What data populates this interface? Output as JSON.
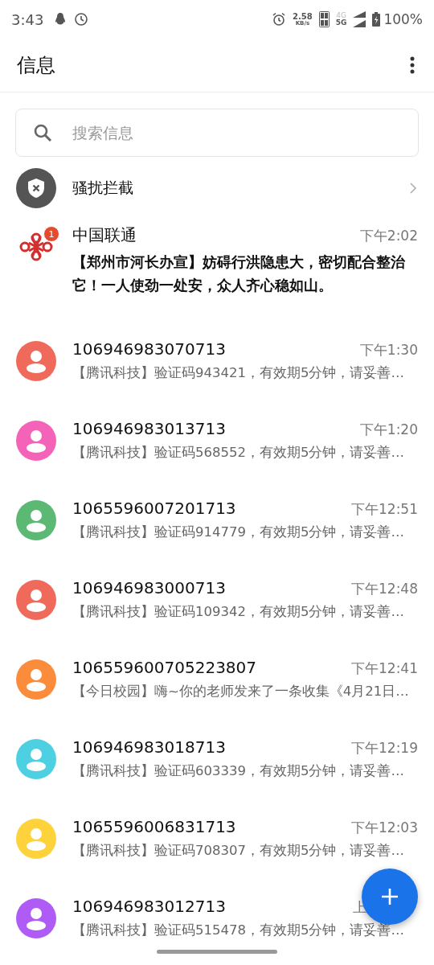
{
  "status_bar": {
    "time": "3:43",
    "net_speed": "2.58",
    "net_unit": "KB/s",
    "sim_top": "4G",
    "sim_bottom": "5G",
    "battery": "100%"
  },
  "header": {
    "title": "信息"
  },
  "search": {
    "placeholder": "搜索信息"
  },
  "spam_filter": {
    "label": "骚扰拦截"
  },
  "conversations": [
    {
      "kind": "logo",
      "name": "中国联通",
      "time": "下午2:02",
      "preview": "【郑州市河长办宣】妨碍行洪隐患大，密切配合整治它！一人使劲一处安，众人齐心稳如山。",
      "unread": true,
      "badge": "1"
    },
    {
      "kind": "avatar",
      "color": "#ef6a5b",
      "name": "106946983070713",
      "time": "下午1:30",
      "preview": "【腾讯科技】验证码943421，有效期5分钟，请妥善…",
      "unread": false
    },
    {
      "kind": "avatar",
      "color": "#f463b7",
      "name": "106946983013713",
      "time": "下午1:20",
      "preview": "【腾讯科技】验证码568552，有效期5分钟，请妥善…",
      "unread": false
    },
    {
      "kind": "avatar",
      "color": "#5bb974",
      "name": "1065596007201713",
      "time": "下午12:51",
      "preview": "【腾讯科技】验证码914779，有效期5分钟，请妥善…",
      "unread": false
    },
    {
      "kind": "avatar",
      "color": "#ef6a5b",
      "name": "106946983000713",
      "time": "下午12:48",
      "preview": "【腾讯科技】验证码109342，有效期5分钟，请妥善…",
      "unread": false
    },
    {
      "kind": "avatar",
      "color": "#fb8c3c",
      "name": "106559600705223807",
      "time": "下午12:41",
      "preview": "【今日校园】嗨~你的老师发来了一条收集《4月21日…",
      "unread": false
    },
    {
      "kind": "avatar",
      "color": "#4dd0e1",
      "name": "106946983018713",
      "time": "下午12:19",
      "preview": "【腾讯科技】验证码603339，有效期5分钟，请妥善…",
      "unread": false
    },
    {
      "kind": "avatar",
      "color": "#fdd23a",
      "name": "1065596006831713",
      "time": "下午12:03",
      "preview": "【腾讯科技】验证码708307，有效期5分钟，请妥善…",
      "unread": false
    },
    {
      "kind": "avatar",
      "color": "#af5cf7",
      "name": "106946983012713",
      "time": "上",
      "preview": "【腾讯科技】验证码515478，有效期5分钟，请妥善…",
      "unread": false
    }
  ]
}
